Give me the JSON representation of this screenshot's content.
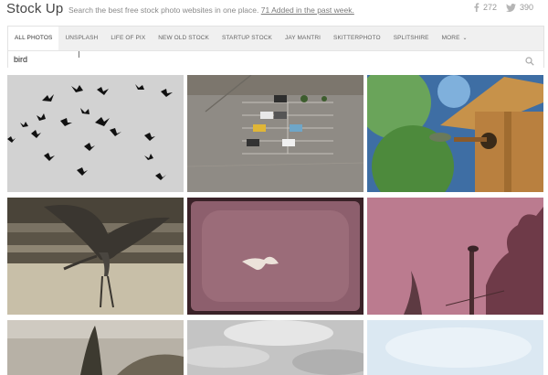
{
  "header": {
    "logo": "Stock Up",
    "tagline_text": "Search the best free stock photo websites in one place.",
    "tagline_link": "71 Added in the past week.",
    "facebook_count": "272",
    "twitter_count": "390"
  },
  "tabs": [
    {
      "label": "ALL PHOTOS",
      "active": true
    },
    {
      "label": "UNSPLASH"
    },
    {
      "label": "LIFE OF PIX"
    },
    {
      "label": "NEW OLD STOCK"
    },
    {
      "label": "STARTUP STOCK"
    },
    {
      "label": "JAY MANTRI"
    },
    {
      "label": "SKITTERPHOTO"
    },
    {
      "label": "SPLITSHIRE"
    },
    {
      "label": "MORE"
    }
  ],
  "search": {
    "value": "bird",
    "icon": "magnifier-icon"
  },
  "photos": [
    {
      "subject": "flock-of-birds"
    },
    {
      "subject": "parking-lot-aerial"
    },
    {
      "subject": "birdhouse"
    },
    {
      "subject": "heron-landing"
    },
    {
      "subject": "egret-flying"
    },
    {
      "subject": "bird-on-post"
    },
    {
      "subject": "dry-plant"
    },
    {
      "subject": "cloudy-sky"
    },
    {
      "subject": "pale-sky"
    }
  ]
}
